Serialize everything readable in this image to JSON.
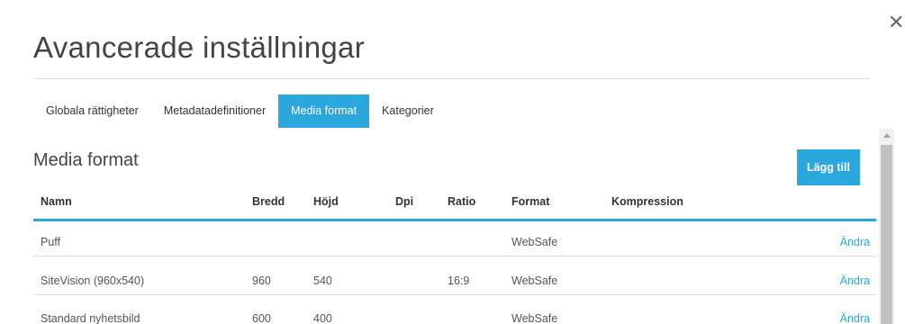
{
  "dialog": {
    "title": "Avancerade inställningar",
    "close_icon": "close-icon",
    "close_glyph": "✕"
  },
  "tabs": [
    {
      "label": "Globala rättigheter",
      "active": false
    },
    {
      "label": "Metadatadefinitioner",
      "active": false
    },
    {
      "label": "Media format",
      "active": true
    },
    {
      "label": "Kategorier",
      "active": false
    }
  ],
  "section": {
    "title": "Media format",
    "add_button_label": "Lägg till"
  },
  "table": {
    "columns": {
      "name": "Namn",
      "width": "Bredd",
      "height": "Höjd",
      "dpi": "Dpi",
      "ratio": "Ratio",
      "format": "Format",
      "compression": "Kompression"
    },
    "rows": [
      {
        "name": "Puff",
        "width": "",
        "height": "",
        "dpi": "",
        "ratio": "",
        "format": "WebSafe",
        "compression": "",
        "action": "Ändra"
      },
      {
        "name": "SiteVision (960x540)",
        "width": "960",
        "height": "540",
        "dpi": "",
        "ratio": "16:9",
        "format": "WebSafe",
        "compression": "",
        "action": "Ändra"
      },
      {
        "name": "Standard nyhetsbild",
        "width": "600",
        "height": "400",
        "dpi": "",
        "ratio": "",
        "format": "WebSafe",
        "compression": "",
        "action": "Ändra"
      }
    ]
  },
  "colors": {
    "accent": "#2aa7dd",
    "divider": "#dddddd",
    "text": "#333333"
  }
}
